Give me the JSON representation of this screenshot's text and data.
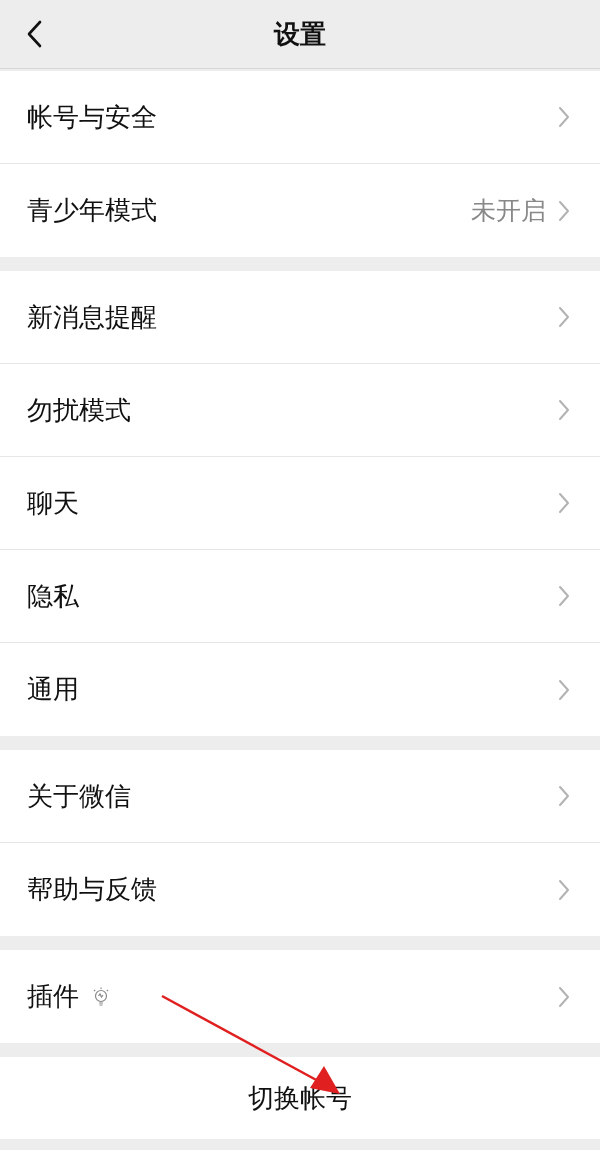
{
  "header": {
    "title": "设置"
  },
  "groups": [
    {
      "items": [
        {
          "label": "帐号与安全"
        },
        {
          "label": "青少年模式",
          "value": "未开启"
        }
      ]
    },
    {
      "items": [
        {
          "label": "新消息提醒"
        },
        {
          "label": "勿扰模式"
        },
        {
          "label": "聊天"
        },
        {
          "label": "隐私"
        },
        {
          "label": "通用"
        }
      ]
    },
    {
      "items": [
        {
          "label": "关于微信"
        },
        {
          "label": "帮助与反馈"
        }
      ]
    },
    {
      "items": [
        {
          "label": "插件",
          "new_icon": true
        }
      ]
    }
  ],
  "switch_account": {
    "label": "切换帐号"
  },
  "annotations": [
    {
      "kind": "arrow"
    }
  ]
}
